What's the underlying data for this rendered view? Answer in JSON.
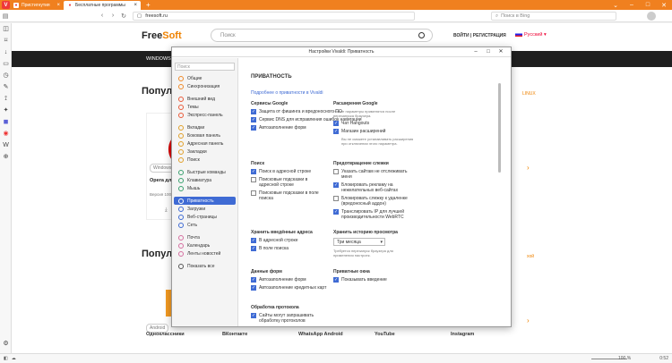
{
  "tabs": [
    {
      "label": "Пристигнутия"
    },
    {
      "label": "Бесплатные программы"
    }
  ],
  "address": {
    "url": "freesoft.ru",
    "search_placeholder": "Поиск в Bing"
  },
  "site": {
    "logo_a": "Free",
    "logo_b": "Soft",
    "search_placeholder": "Поиск",
    "login": "ВОЙТИ | РЕГИСТРАЦИЯ",
    "lang": "Русский",
    "nav_item": "WINDOWS",
    "nav_right": "LINUX",
    "heading1": "Популярные",
    "heading2": "Популярные",
    "more_right": "LINUX",
    "more_right2": "хой",
    "card_tag": "Windows",
    "card_title": "Opera для Wi",
    "card_version": "Версия 100",
    "android_tag": "Android",
    "apps": [
      "Одноклассники",
      "ВКонтакте",
      "WhatsApp Android",
      "YouTube",
      "Instagram"
    ]
  },
  "dialog": {
    "title": "Настройки Vivaldi: Приватность",
    "sidebar_search": "Поиск",
    "sidebar": [
      {
        "label": "Общие",
        "color": "#f08b2a"
      },
      {
        "label": "Синхронизация",
        "color": "#f08b2a"
      },
      {
        "label": "Внешний вид",
        "color": "#ea5b3a"
      },
      {
        "label": "Темы",
        "color": "#ea5b3a"
      },
      {
        "label": "Экспресс-панель",
        "color": "#ea5b3a"
      },
      {
        "label": "Вкладки",
        "color": "#e1a02a"
      },
      {
        "label": "Боковая панель",
        "color": "#e1a02a"
      },
      {
        "label": "Адресная панель",
        "color": "#e1a02a"
      },
      {
        "label": "Закладки",
        "color": "#e1a02a"
      },
      {
        "label": "Поиск",
        "color": "#e1a02a"
      },
      {
        "label": "Быстрые команды",
        "color": "#3aa16f"
      },
      {
        "label": "Клавиатура",
        "color": "#3aa16f"
      },
      {
        "label": "Мышь",
        "color": "#3aa16f"
      },
      {
        "label": "Приватность",
        "color": "#ffffff"
      },
      {
        "label": "Загрузки",
        "color": "#3f6bd4"
      },
      {
        "label": "Веб-страницы",
        "color": "#3f6bd4"
      },
      {
        "label": "Сеть",
        "color": "#3f6bd4"
      },
      {
        "label": "Почта",
        "color": "#d66fa0"
      },
      {
        "label": "Календарь",
        "color": "#d66fa0"
      },
      {
        "label": "Ленты новостей",
        "color": "#d66fa0"
      },
      {
        "label": "Показать все",
        "color": "#555555"
      }
    ],
    "heading": "ПРИВАТНОСТЬ",
    "link": "Подробнее о приватности в Vivaldi",
    "google_services": {
      "title": "Сервисы Google",
      "items": [
        {
          "label": "Защита от фишинга и вредоносного ПО",
          "checked": true
        },
        {
          "label": "Сервис DNS для исправления ошибок навигации",
          "checked": true
        },
        {
          "label": "Автозаполнение форм",
          "checked": true
        }
      ]
    },
    "google_ext": {
      "title": "Расширения Google",
      "desc": "Новые параметры применятся после перезапуска браузера.",
      "items": [
        {
          "label": "Чат Hangouts",
          "checked": true
        },
        {
          "label": "Магазин расширений",
          "checked": true
        }
      ],
      "note": "Вы не сможете устанавливать расширения при отключении этого параметра."
    },
    "search": {
      "title": "Поиск",
      "items": [
        {
          "label": "Поиск в адресной строке",
          "checked": true
        },
        {
          "label": "Поисковые подсказки в адресной строке",
          "checked": false
        },
        {
          "label": "Поисковые подсказки в поле поиска",
          "checked": false
        }
      ]
    },
    "tracking": {
      "title": "Предотвращение слежки",
      "items": [
        {
          "label": "Указать сайтам не отслеживать меня",
          "checked": false
        },
        {
          "label": "Блокировать рекламу на нежелательных веб-сайтах",
          "checked": true
        },
        {
          "label": "Блокировать слежку к удаленке (вредоносный аддон)",
          "checked": false
        },
        {
          "label": "Транслировать IP для лучшей производительности WebRTC",
          "checked": true
        }
      ]
    },
    "typed": {
      "title": "Хранить введённые адреса",
      "items": [
        {
          "label": "В адресной строке",
          "checked": true
        },
        {
          "label": "В поле поиска",
          "checked": true
        }
      ]
    },
    "history": {
      "title": "Хранить историю просмотра",
      "value": "Три месяца",
      "desc": "Требуется перезапуск браузера для применения настроек."
    },
    "forms": {
      "title": "Данные форм",
      "items": [
        {
          "label": "Автозаполнение форм",
          "checked": true
        },
        {
          "label": "Автозаполнение кредитных карт",
          "checked": true
        }
      ]
    },
    "private": {
      "title": "Приватные окна",
      "items": [
        {
          "label": "Показывать введение",
          "checked": true
        }
      ]
    },
    "protocol": {
      "title": "Обработка протокола",
      "items": [
        {
          "label": "Сайты могут запрашивать обработку протоколов",
          "checked": true
        }
      ]
    }
  },
  "status": {
    "zoom": "100 %",
    "time": "0:52"
  }
}
